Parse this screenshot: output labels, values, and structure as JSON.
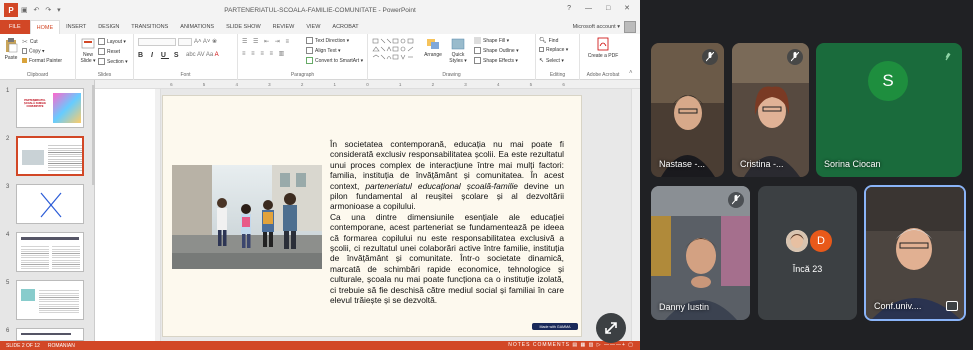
{
  "ppt": {
    "window_title": "PARTENERIATUL-SCOALA-FAMILIE-COMUNITATE - PowerPoint",
    "qa_toolbar": "▣ ↶ ↷ ▾",
    "window_controls": "? — □ ✕",
    "account": "Microsoft account ▾",
    "tabs": [
      "FILE",
      "HOME",
      "INSERT",
      "DESIGN",
      "TRANSITIONS",
      "ANIMATIONS",
      "SLIDE SHOW",
      "REVIEW",
      "VIEW",
      "ACROBAT"
    ],
    "ribbon": {
      "clipboard": {
        "paste": "Paste",
        "cut": "Cut",
        "copy": "Copy ▾",
        "format_painter": "Format Painter",
        "label": "Clipboard"
      },
      "slides": {
        "new_slide": "New Slide ▾",
        "layout": "Layout ▾",
        "reset": "Reset",
        "section": "Section ▾",
        "label": "Slides"
      },
      "font": {
        "label": "Font"
      },
      "paragraph": {
        "text_direction": "Text Direction ▾",
        "align_text": "Align Text ▾",
        "smartart": "Convert to SmartArt ▾",
        "label": "Paragraph"
      },
      "drawing": {
        "arrange": "Arrange",
        "quick_styles": "Quick Styles ▾",
        "shape_fill": "Shape Fill ▾",
        "shape_outline": "Shape Outline ▾",
        "shape_effects": "Shape Effects ▾",
        "label": "Drawing"
      },
      "editing": {
        "find": "Find",
        "replace": "Replace ▾",
        "select": "Select ▾",
        "label": "Editing"
      },
      "acrobat": {
        "create_pdf": "Create a PDF",
        "label": "Adobe Acrobat"
      }
    },
    "ruler_marks": [
      "6",
      "5",
      "4",
      "3",
      "2",
      "1",
      "0",
      "1",
      "2",
      "3",
      "4",
      "5",
      "6"
    ],
    "thumbnail_numbers": [
      "1",
      "2",
      "3",
      "4",
      "5",
      "6"
    ],
    "thumb1_title": "PARTENERIATUL ȘCOALĂ FAMILIE COMUNITATE",
    "slide_text": {
      "p1_a": "În societatea contemporană, educația nu mai poate fi considerată exclusiv responsabilitatea școlii. Ea este rezultatul unui proces complex de interacțiune între mai mulți factori: familia, instituția de învățământ și comunitatea. În acest context, ",
      "p1_em": "parteneriatul educațional școală-familie",
      "p1_b": " devine un pilon fundamental al reușitei școlare și al dezvoltării armonioase a copilului.",
      "p2": "Ca una dintre dimensiunile esențiale ale educației contemporane, acest parteneriat se fundamentează pe ideea că formarea copilului nu este responsabilitatea exclusivă a școlii, ci rezultatul unei colaborări active între familie, instituția de învățământ și comunitate. Într-o societate dinamică, marcată de schimbări rapide economice, tehnologice și culturale, școala nu mai poate funcționa ca o instituție izolată, ci trebuie să fie deschisă către mediul social și familiai în care elevul trăiește și se dezvoltă."
    },
    "made_with": "Made with GAMMA",
    "status": {
      "slide": "SLIDE 2 OF 12",
      "language": "ROMANIAN",
      "right": "NOTES  COMMENTS  ▤ ▦ ▥ ▷  ———+  ▢"
    }
  },
  "meet": {
    "participants": [
      {
        "name": "Nastase -...",
        "muted": true
      },
      {
        "name": "Cristina -...",
        "muted": true
      },
      {
        "name": "Sorina Ciocan",
        "initial": "S",
        "muted": false,
        "speaking": true
      },
      {
        "name": "Danny Iustin",
        "muted": true
      },
      {
        "name": "Încă 23",
        "initial": "D"
      },
      {
        "name": "Conf.univ....",
        "active": true
      }
    ],
    "colors": {
      "green_tile": "#1a6b3c",
      "accent_blue": "#8ab4f8",
      "orange_avatar": "#e8591a"
    }
  }
}
